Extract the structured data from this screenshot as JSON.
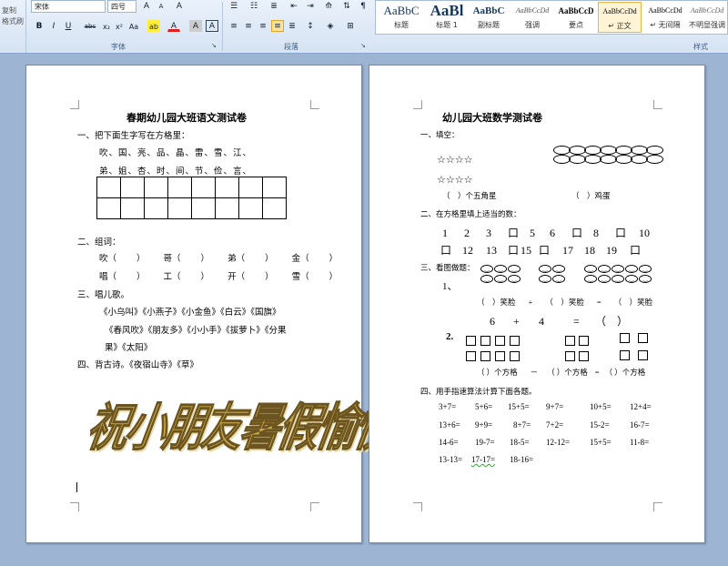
{
  "ribbon": {
    "clipboard": {
      "copy_label": "复制",
      "format_painter_label": "格式刷"
    },
    "font": {
      "font_name": "宋体",
      "font_size": "四号",
      "group_label": "字体",
      "bold": "B",
      "italic": "I",
      "underline": "U",
      "strike": "abc",
      "subscript": "x₂",
      "superscript": "x²",
      "change_case": "Aa",
      "highlight": "ab",
      "font_color": "A",
      "char_shading": "A",
      "grow": "A",
      "shrink": "A",
      "clear_format": "A"
    },
    "paragraph": {
      "group_label": "段落"
    },
    "styles": {
      "group_label": "样式",
      "items": [
        {
          "sample": "AaBbC",
          "name": "标题"
        },
        {
          "sample": "AaBl",
          "name": "标题 1"
        },
        {
          "sample": "AaBbC",
          "name": "副标题"
        },
        {
          "sample": "AaBbCcDd",
          "name": "强调"
        },
        {
          "sample": "AaBbCcD",
          "name": "要点"
        },
        {
          "sample": "AaBbCcDd",
          "name": "↵ 正文"
        },
        {
          "sample": "AaBbCcDd",
          "name": "↵ 无间隔"
        },
        {
          "sample": "AaBbCcDd",
          "name": "不明显强调"
        }
      ]
    }
  },
  "left_page": {
    "title": "春期幼儿园大班语文测试卷",
    "q1": "一、把下面生字写在方格里：",
    "q1_line1": "吹、国、亮、品、晶、雷、雪、江、",
    "q1_line2": "弟、姐、杏、时、间、节、俭、言、",
    "q2": "二、组词：",
    "q2_row1": [
      "吹（",
      "）",
      "哥（",
      "）",
      "弟（",
      "）",
      "金（",
      "）"
    ],
    "q2_row2": [
      "唱（",
      "）",
      "工（",
      "）",
      "开（",
      "）",
      "雪（",
      "）"
    ],
    "q3": "三、唱儿歌。",
    "q3_line1": "《小乌叫》《小燕子》《小金鱼》《白云》《国旗》",
    "q3_line2": "《春风吹》《朋友多》《小小手》《拔萝卜》《分果",
    "q3_line3": "果》《太阳》",
    "q4": "四、背古诗。《夜宿山寺》《草》",
    "wordart": "祝小朋友暑假愉快！"
  },
  "right_page": {
    "title": "幼儿园大班数学测试卷",
    "q1": "一、填空：",
    "stars_row1": "☆☆☆☆",
    "stars_row2": "☆☆☆☆",
    "q1_answer_left": "（　）个五角星",
    "q1_answer_right": "（　）鸡蛋",
    "q2": "二、在方格里填上适当的数：",
    "q2_row1": [
      "1",
      "2",
      "3",
      "口",
      "5",
      "6",
      "口",
      "8",
      "口",
      "10"
    ],
    "q2_row2": [
      "口",
      "12",
      "13",
      "口",
      "15",
      "口",
      "17",
      "18",
      "19",
      "口"
    ],
    "q3": "三、看图做题：",
    "q3_1_label": "1、",
    "q3_1_answer": [
      "（　）笑脸",
      "+",
      "（　）笑脸",
      "=",
      "（　）笑脸"
    ],
    "q3_1_equation": [
      "6",
      "+",
      "4",
      "=",
      "（　）"
    ],
    "q3_2_label": "2.",
    "q3_2_answer": [
      "（ ）个方格",
      "－",
      "（ ）个方格",
      "=",
      "（ ）个方格"
    ],
    "q4": "四、用手指速算法计算下面各题。",
    "q4_rows": [
      [
        "3+7=",
        "5+6=",
        "15+5=",
        "9+7=",
        "10+5=",
        "12+4="
      ],
      [
        "13+6=",
        "9+9=",
        "8+7=",
        "7+2=",
        "15-2=",
        "16-7="
      ],
      [
        "14-6=",
        "19-7=",
        "18-5=",
        "12-12=",
        "15+5=",
        "11-8="
      ],
      [
        "13-13=",
        "17-17=",
        "18-16=",
        "",
        "",
        ""
      ]
    ]
  }
}
